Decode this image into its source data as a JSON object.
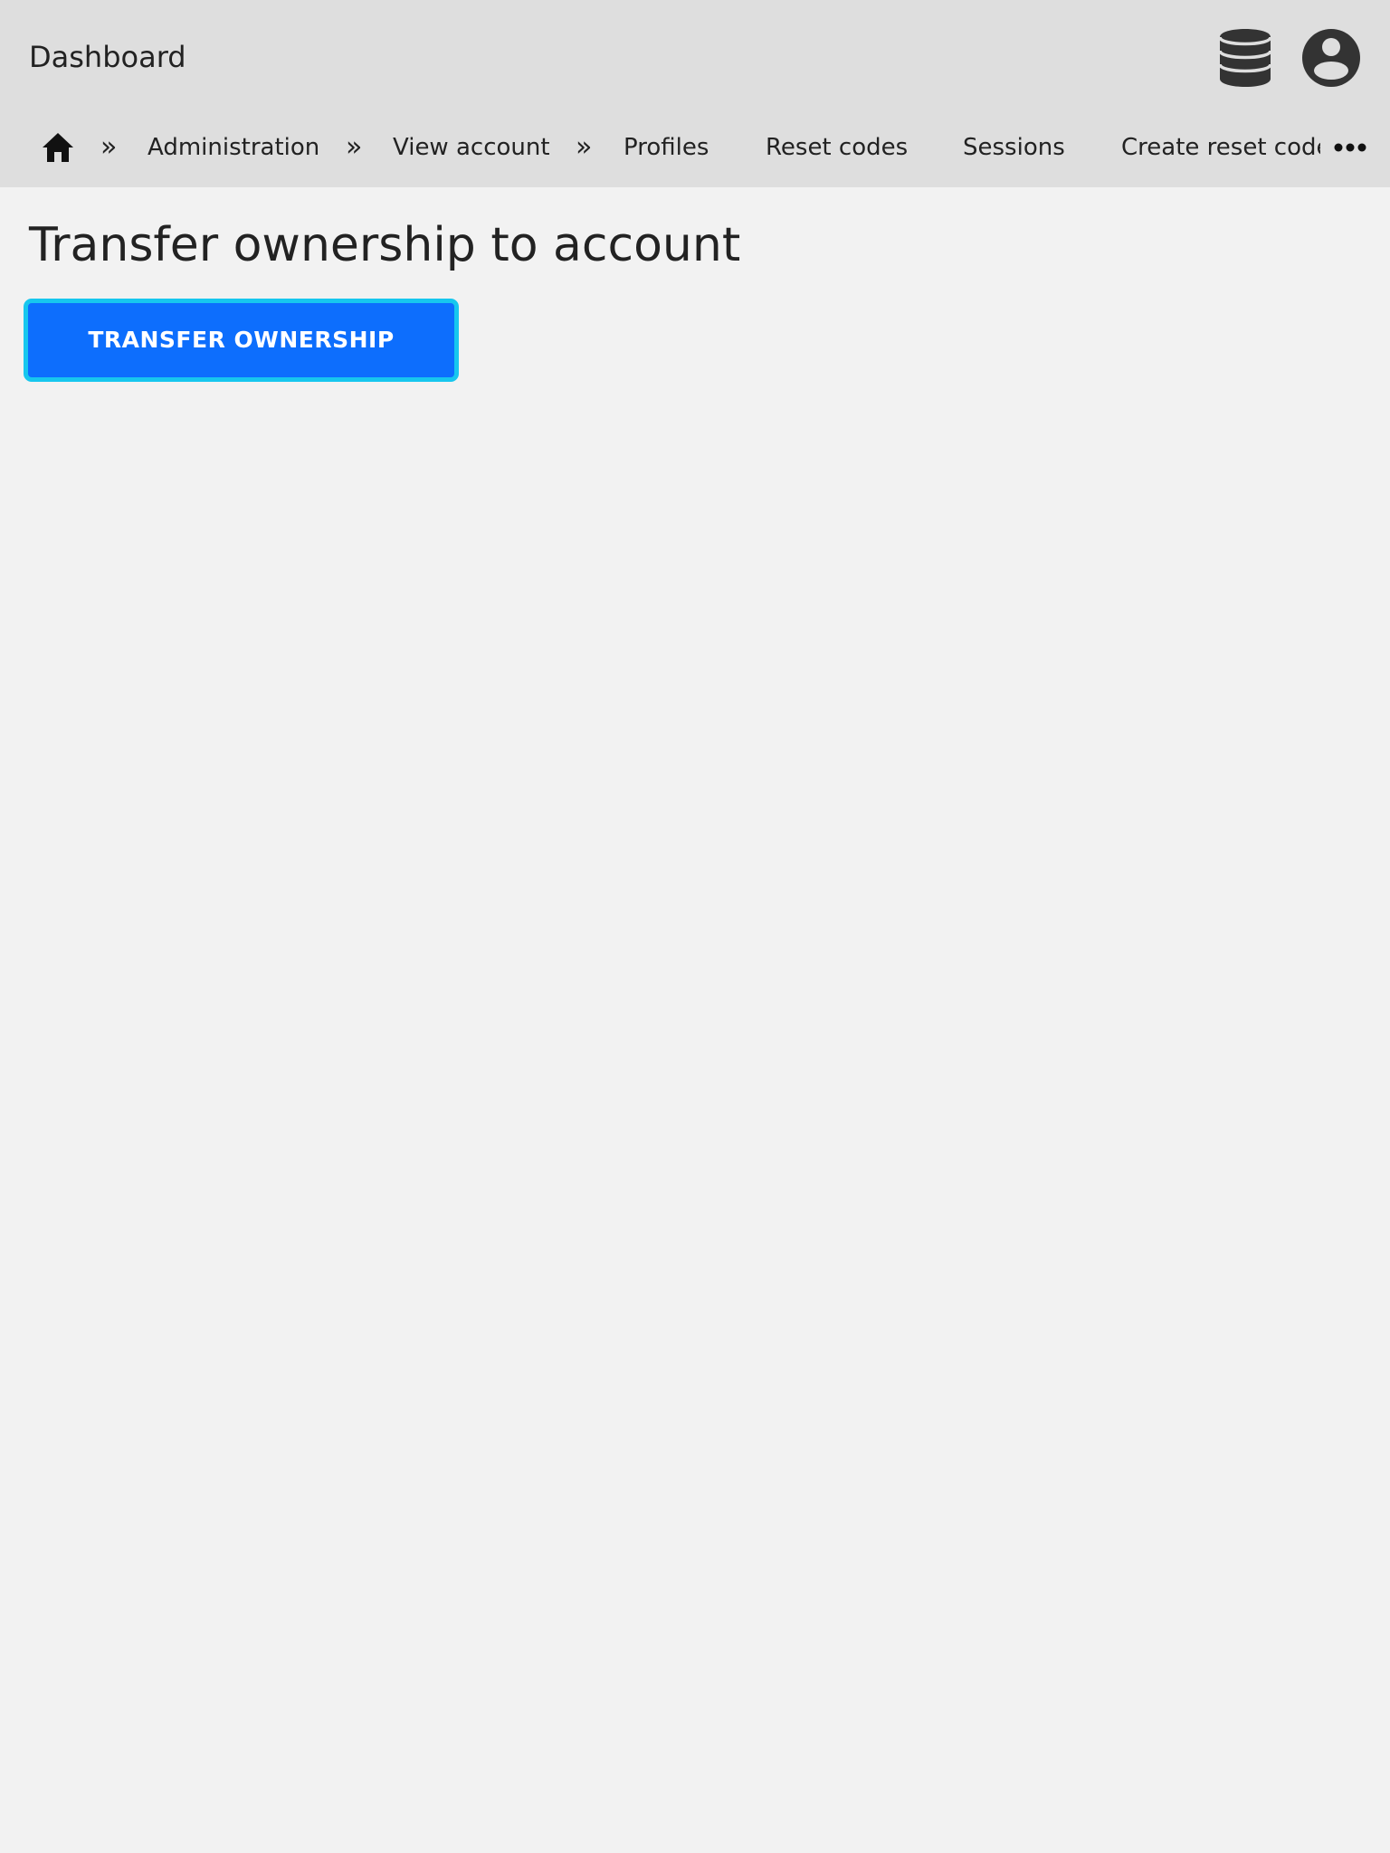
{
  "header": {
    "title": "Dashboard",
    "icons": {
      "database": "database-icon",
      "account": "account-circle-icon"
    },
    "icon_color": "#333333"
  },
  "nav": {
    "home_icon": "home-icon",
    "separator": "»",
    "items": [
      {
        "label": "Administration"
      },
      {
        "label": "View account"
      },
      {
        "label": "Profiles"
      },
      {
        "label": "Reset codes"
      },
      {
        "label": "Sessions"
      },
      {
        "label": "Create reset code"
      }
    ],
    "more_icon": "more-horizontal-icon"
  },
  "main": {
    "page_title": "Transfer ownership to account",
    "transfer_button_label": "TRANSFER OWNERSHIP"
  },
  "colors": {
    "header_bg": "#dedede",
    "page_bg": "#f2f2f2",
    "primary": "#0d6efd",
    "focus_ring": "#17c7ee",
    "text": "#222222"
  }
}
